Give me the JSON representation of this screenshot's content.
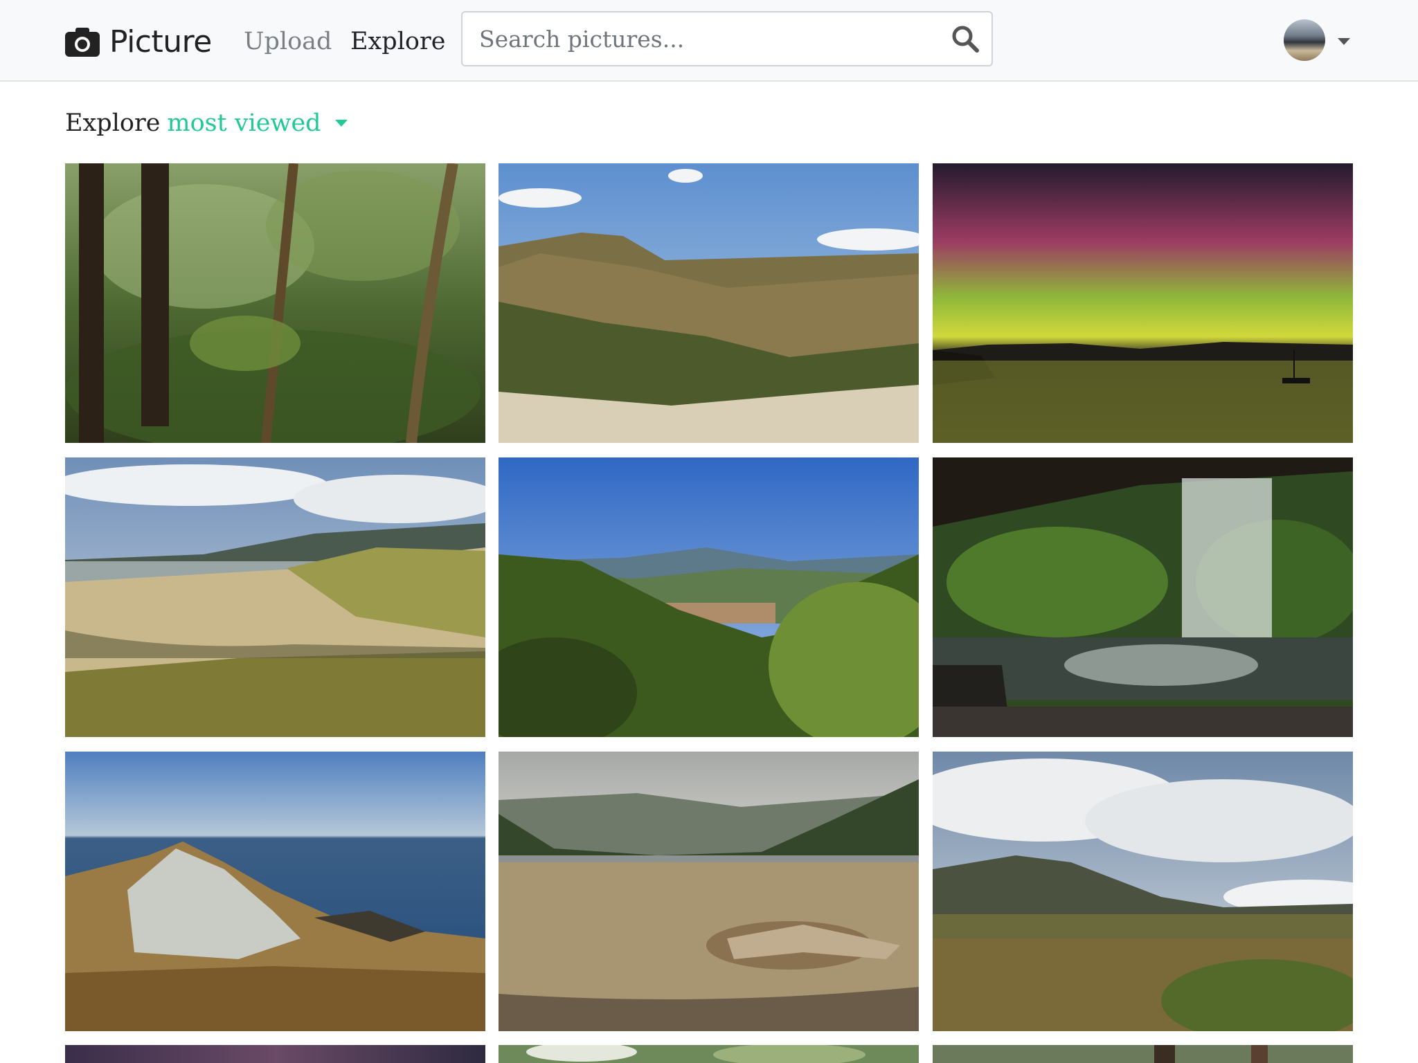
{
  "app": {
    "brand": "Picture",
    "brand_icon": "camera-icon",
    "accent_color": "#20c997"
  },
  "nav": {
    "upload": "Upload",
    "explore": "Explore"
  },
  "search": {
    "placeholder": "Search pictures...",
    "icon": "search-icon"
  },
  "user": {
    "avatar": "avatar",
    "menu_icon": "caret-down-icon"
  },
  "page": {
    "heading_prefix": "Explore",
    "sort_label": "most viewed"
  },
  "photos": [
    {
      "subject": "rainforest"
    },
    {
      "subject": "mountain-valley"
    },
    {
      "subject": "aurora-lake"
    },
    {
      "subject": "beach-dunes"
    },
    {
      "subject": "green-hills"
    },
    {
      "subject": "waterfall-cave"
    },
    {
      "subject": "rocky-summit-sea"
    },
    {
      "subject": "beach-driftwood"
    },
    {
      "subject": "grassland-clouds"
    },
    {
      "subject": "sunset"
    },
    {
      "subject": "forest-light"
    },
    {
      "subject": "forest-trunks"
    }
  ]
}
